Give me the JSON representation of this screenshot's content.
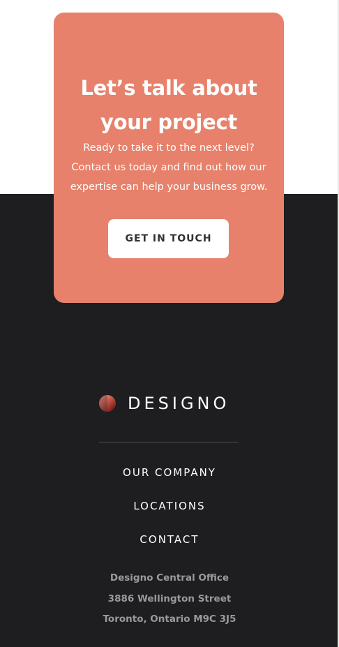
{
  "cta": {
    "title": "Let’s talk about your project",
    "description": "Ready to take it to the next level? Contact us today and find out how our expertise can help your business grow.",
    "button_label": "GET IN TOUCH"
  },
  "footer": {
    "brand_name": "DESIGNO",
    "nav": [
      {
        "label": "OUR COMPANY"
      },
      {
        "label": "LOCATIONS"
      },
      {
        "label": "CONTACT"
      }
    ],
    "address": {
      "line1": "Designo Central Office",
      "line2": "3886 Wellington Street",
      "line3": "Toronto, Ontario M9C 3J5"
    }
  },
  "colors": {
    "accent": "#e7816b",
    "footer_bg": "#1e1d1f",
    "footer_text": "#ffffff",
    "footer_muted": "#9a9a9a",
    "button_text": "#333136"
  },
  "icons": {
    "brand_logo": "designo-logo-icon"
  }
}
